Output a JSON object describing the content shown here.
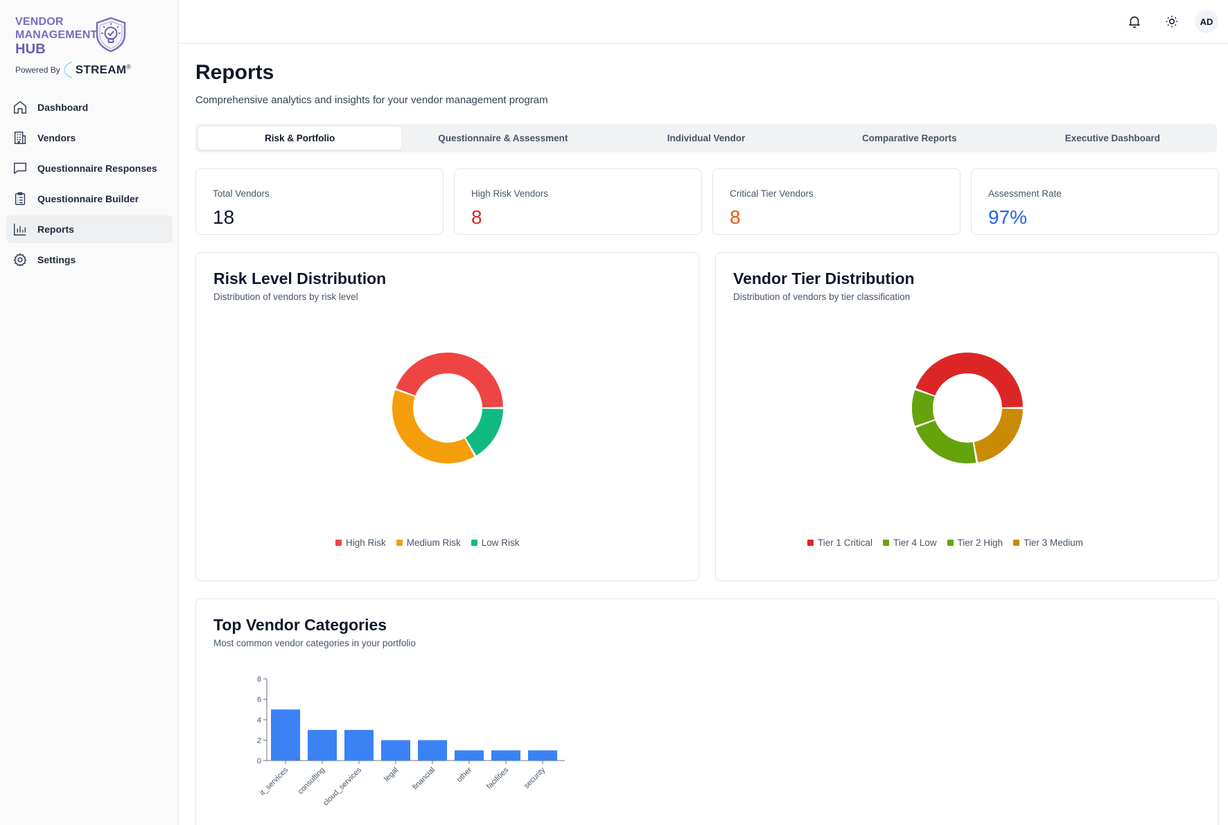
{
  "brand": {
    "line1": "VENDOR",
    "line2": "MANAGEMENT",
    "line3": "HUB",
    "powered_by": "Powered By",
    "stream": "STREAM",
    "registered": "®"
  },
  "sidebar": {
    "items": [
      {
        "label": "Dashboard",
        "icon": "home-icon"
      },
      {
        "label": "Vendors",
        "icon": "building-icon"
      },
      {
        "label": "Questionnaire Responses",
        "icon": "message-square-icon"
      },
      {
        "label": "Questionnaire Builder",
        "icon": "clipboard-list-icon"
      },
      {
        "label": "Reports",
        "icon": "bar-chart-icon",
        "active": true
      },
      {
        "label": "Settings",
        "icon": "gear-icon"
      }
    ]
  },
  "topbar": {
    "bell_icon": "bell-icon",
    "theme_icon": "sun-icon",
    "avatar_initials": "AD"
  },
  "page": {
    "title": "Reports",
    "subtitle": "Comprehensive analytics and insights for your vendor management program"
  },
  "tabs": [
    {
      "label": "Risk & Portfolio",
      "active": true
    },
    {
      "label": "Questionnaire & Assessment"
    },
    {
      "label": "Individual Vendor"
    },
    {
      "label": "Comparative Reports"
    },
    {
      "label": "Executive Dashboard"
    }
  ],
  "stats": [
    {
      "label": "Total Vendors",
      "value": "18",
      "color": "#0f172a"
    },
    {
      "label": "High Risk Vendors",
      "value": "8",
      "color": "#dc2626"
    },
    {
      "label": "Critical Tier Vendors",
      "value": "8",
      "color": "#ea580c"
    },
    {
      "label": "Assessment Rate",
      "value": "97%",
      "color": "#2563eb"
    }
  ],
  "risk_card": {
    "title": "Risk Level Distribution",
    "subtitle": "Distribution of vendors by risk level"
  },
  "tier_card": {
    "title": "Vendor Tier Distribution",
    "subtitle": "Distribution of vendors by tier classification"
  },
  "categories_card": {
    "title": "Top Vendor Categories",
    "subtitle": "Most common vendor categories in your portfolio"
  },
  "chart_data": [
    {
      "type": "pie",
      "variant": "donut",
      "labels": [
        "High Risk",
        "Low Risk",
        "Medium Risk"
      ],
      "values": [
        8,
        3,
        7
      ],
      "colors": [
        "#ef4444",
        "#10b981",
        "#f59e0b"
      ],
      "legend": [
        "High Risk",
        "Medium Risk",
        "Low Risk"
      ],
      "legend_colors": [
        "#ef4444",
        "#f59e0b",
        "#10b981"
      ],
      "legend_position": "bottom"
    },
    {
      "type": "pie",
      "variant": "donut",
      "labels": [
        "Tier 1 Critical",
        "Tier 3 Medium",
        "Tier 2 High",
        "Tier 4 Low"
      ],
      "values": [
        8,
        4,
        4,
        2
      ],
      "colors": [
        "#dc2626",
        "#ca8a04",
        "#65a30d",
        "#65a30d"
      ],
      "legend": [
        "Tier 1 Critical",
        "Tier 4 Low",
        "Tier 2 High",
        "Tier 3 Medium"
      ],
      "legend_colors": [
        "#dc2626",
        "#65a30d",
        "#65a30d",
        "#ca8a04"
      ],
      "legend_position": "bottom"
    },
    {
      "type": "bar",
      "categories": [
        "it_services",
        "consulting",
        "cloud_services",
        "legal",
        "financial",
        "other",
        "facilities",
        "security"
      ],
      "values": [
        5,
        3,
        3,
        2,
        2,
        1,
        1,
        1
      ],
      "ylim": [
        0,
        8
      ],
      "yticks": [
        0,
        2,
        4,
        6,
        8
      ],
      "color": "#3b82f6",
      "xlabel": "",
      "ylabel": ""
    }
  ]
}
